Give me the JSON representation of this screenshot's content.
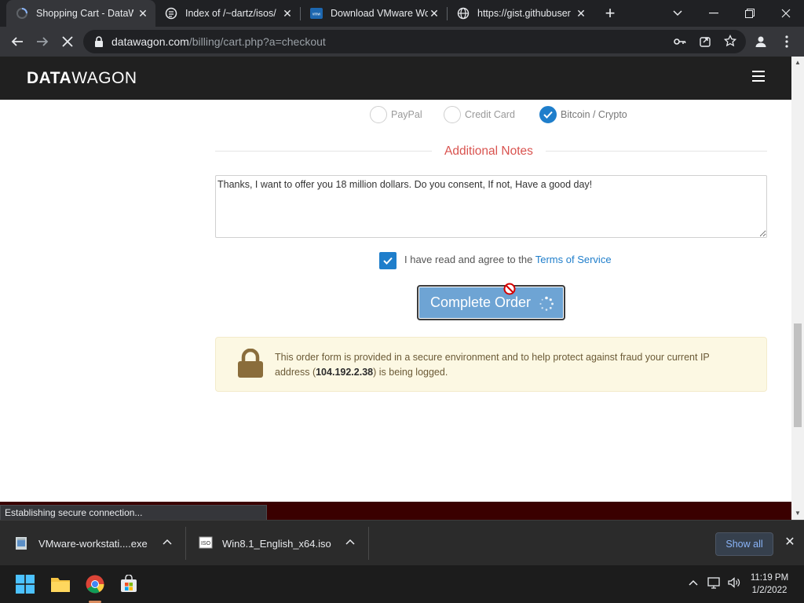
{
  "browser": {
    "tabs": [
      {
        "title": "Shopping Cart - DataW",
        "active": true
      },
      {
        "title": "Index of /~dartz/isos/",
        "active": false
      },
      {
        "title": "Download VMware Wo",
        "active": false
      },
      {
        "title": "https://gist.githubuser",
        "active": false
      }
    ],
    "url_host": "datawagon.com",
    "url_path": "/billing/cart.php?a=checkout",
    "status_text": "Establishing secure connection..."
  },
  "site": {
    "logo_bold": "DATA",
    "logo_light": "WAGON"
  },
  "payment": {
    "options": [
      {
        "label": "PayPal",
        "selected": false
      },
      {
        "label": "Credit Card",
        "selected": false
      },
      {
        "label": "Bitcoin / Crypto",
        "selected": true
      }
    ]
  },
  "notes": {
    "heading": "Additional Notes",
    "value": "Thanks, I want to offer you 18 million dollars. Do you consent, If not, Have a good day!"
  },
  "tos": {
    "text": "I have read and agree to the",
    "link": "Terms of Service",
    "checked": true
  },
  "order": {
    "button_label": "Complete Order"
  },
  "secure_notice": {
    "text_before": "This order form is provided in a secure environment and to help protect against fraud your current IP address (",
    "ip": "104.192.2.38",
    "text_after": ") is being logged."
  },
  "downloads": {
    "items": [
      {
        "name": "VMware-workstati....exe"
      },
      {
        "name": "Win8.1_English_x64.iso"
      }
    ],
    "show_all_label": "Show all"
  },
  "taskbar": {
    "time": "11:19 PM",
    "date": "1/2/2022"
  },
  "colors": {
    "accent_blue": "#1f7ecb",
    "notes_heading_red": "#d9534f",
    "header_bg": "#202020",
    "notice_bg": "#fcf8e3"
  }
}
